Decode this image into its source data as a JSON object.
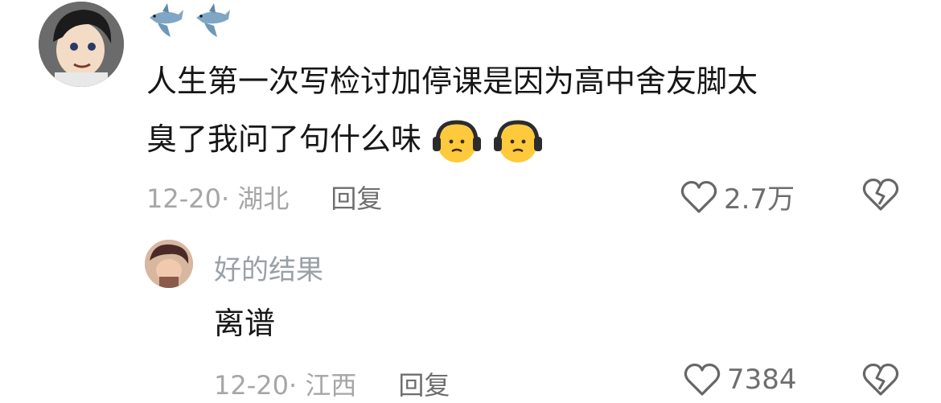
{
  "comment": {
    "username_emojis": [
      "shark-emoji",
      "shark-emoji"
    ],
    "text_line1": "人生第一次写检讨加停课是因为高中舍友脚太",
    "text_line2": "臭了我问了句什么味",
    "trailing_emojis": [
      "headphones-face-emoji",
      "headphones-face-emoji"
    ],
    "date_location": "12-20· 湖北",
    "reply_label": "回复",
    "like_count": "2.7万"
  },
  "reply": {
    "username": "好的结果",
    "text": "离谱",
    "date_location": "12-20· 江西",
    "reply_label": "回复",
    "like_count": "7384"
  }
}
